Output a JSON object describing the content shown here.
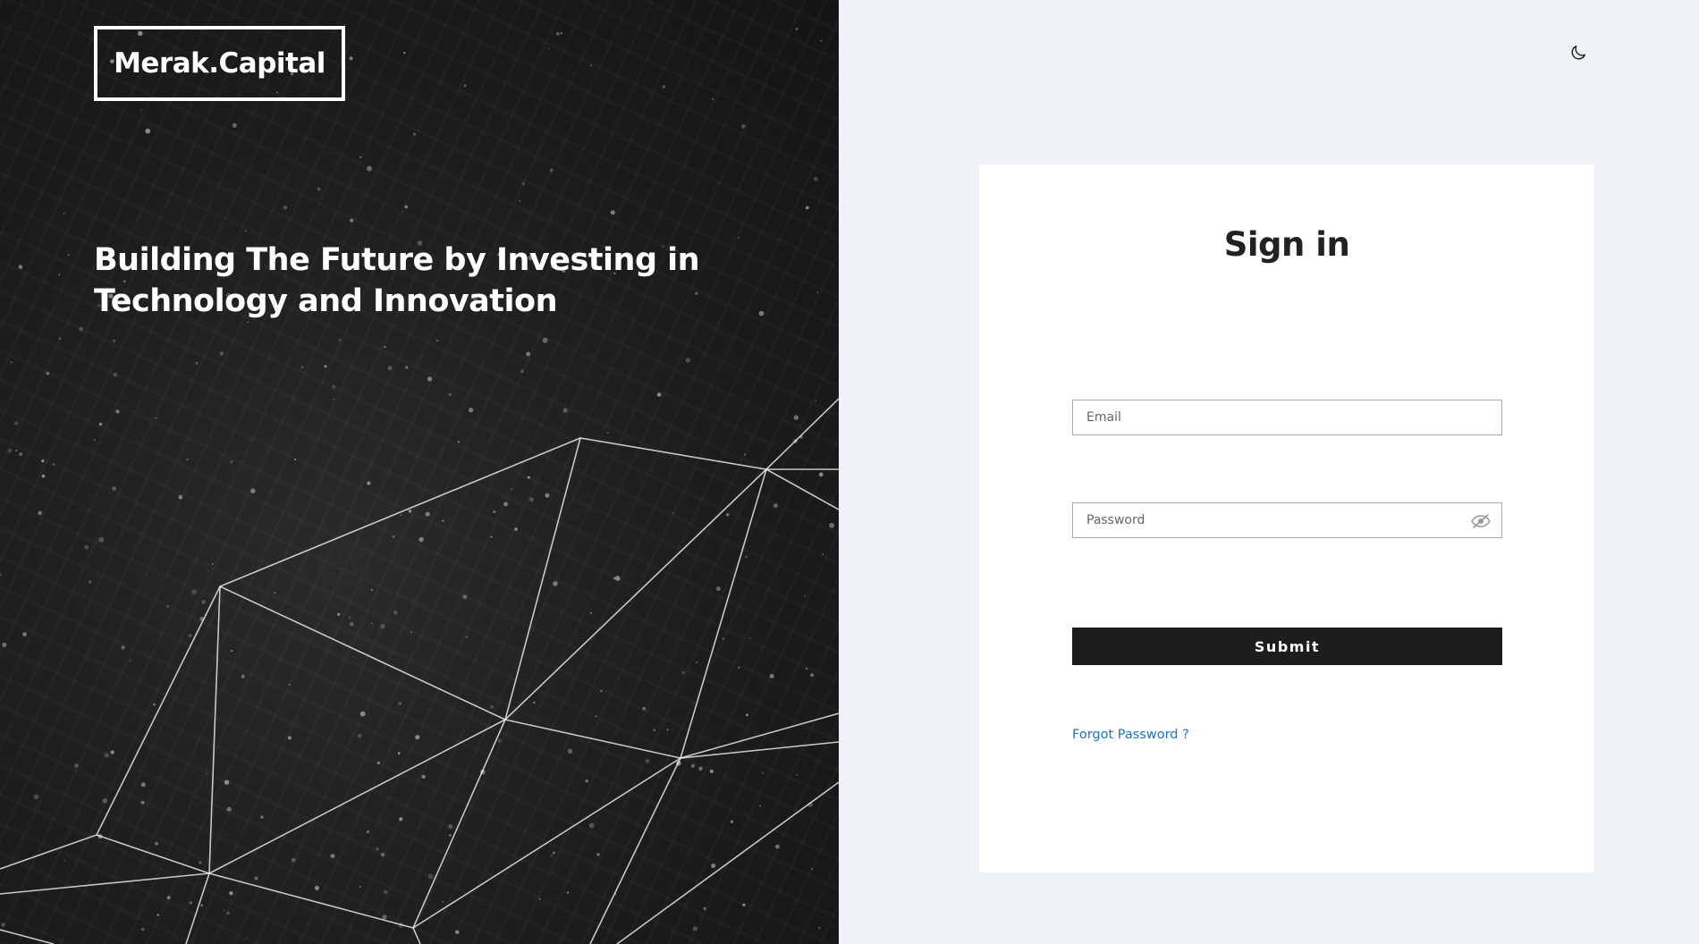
{
  "brand": {
    "logo_text": "Merak.Capital"
  },
  "hero": {
    "tagline_line1": "Building The Future by Investing in",
    "tagline_line2": "Technology and Innovation"
  },
  "header": {
    "theme_toggle_icon": "moon-icon"
  },
  "signin": {
    "title": "Sign in",
    "email_placeholder": "Email",
    "password_placeholder": "Password",
    "password_visibility_icon": "eye-off-icon",
    "submit_label": "Submit",
    "forgot_password_label": "Forgot Password ?"
  },
  "colors": {
    "left_panel_bg": "#1c1c1d",
    "right_panel_bg": "#eff2f6",
    "card_bg": "#ffffff",
    "button_bg": "#1d1d1f",
    "link": "#1a73c8"
  }
}
